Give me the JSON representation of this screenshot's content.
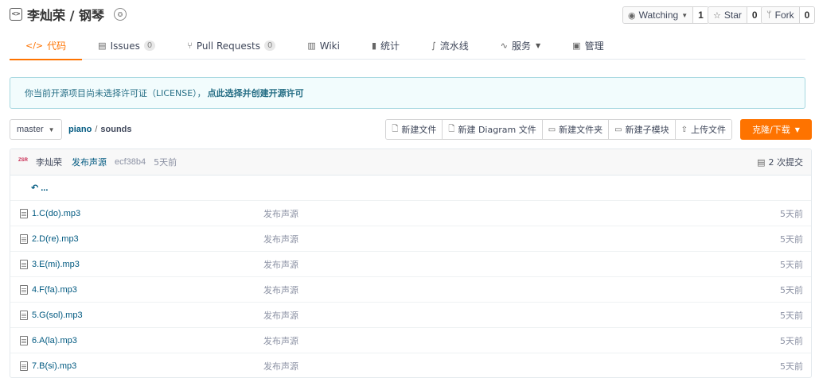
{
  "repo": {
    "icon": "repo-code-icon",
    "title": "李灿荣 / 钢琴",
    "badge_icon": "award-icon"
  },
  "actions": {
    "watch_label": "Watching",
    "watch_count": "1",
    "star_label": "Star",
    "star_count": "0",
    "fork_label": "Fork",
    "fork_count": "0"
  },
  "tabs": [
    {
      "label": "代码",
      "icon": "code-icon"
    },
    {
      "label": "Issues",
      "icon": "issues-icon",
      "count": "0"
    },
    {
      "label": "Pull Requests",
      "icon": "pull-request-icon",
      "count": "0"
    },
    {
      "label": "Wiki",
      "icon": "wiki-icon"
    },
    {
      "label": "统计",
      "icon": "chart-icon"
    },
    {
      "label": "流水线",
      "icon": "pipeline-icon"
    },
    {
      "label": "服务",
      "icon": "pulse-icon"
    },
    {
      "label": "管理",
      "icon": "settings-doc-icon"
    }
  ],
  "notice": {
    "text": "你当前开源项目尚未选择许可证（LICENSE），",
    "link": "点此选择并创建开源许可"
  },
  "branch": {
    "label": "master"
  },
  "breadcrumb": {
    "root": "piano",
    "sep": "/",
    "dir": "sounds"
  },
  "toolbar": {
    "new_file": "新建文件",
    "new_diagram": "新建 Diagram 文件",
    "new_folder": "新建文件夹",
    "new_submodule": "新建子模块",
    "upload": "上传文件",
    "clone": "克隆/下载"
  },
  "commit": {
    "avatar_text": "ZSR",
    "author": "李灿荣",
    "message": "发布声源",
    "hash": "ecf38b4",
    "time": "5天前",
    "count": "2 次提交"
  },
  "back_row": {
    "label": "..."
  },
  "files": [
    {
      "name": "1.C(do).mp3",
      "message": "发布声源",
      "time": "5天前"
    },
    {
      "name": "2.D(re).mp3",
      "message": "发布声源",
      "time": "5天前"
    },
    {
      "name": "3.E(mi).mp3",
      "message": "发布声源",
      "time": "5天前"
    },
    {
      "name": "4.F(fa).mp3",
      "message": "发布声源",
      "time": "5天前"
    },
    {
      "name": "5.G(sol).mp3",
      "message": "发布声源",
      "time": "5天前"
    },
    {
      "name": "6.A(la).mp3",
      "message": "发布声源",
      "time": "5天前"
    },
    {
      "name": "7.B(si).mp3",
      "message": "发布声源",
      "time": "5天前"
    }
  ],
  "colors": {
    "accent": "#fe7300",
    "link": "#005980",
    "notice_bg": "#f2fcfd",
    "notice_border": "#a6d7e0"
  }
}
